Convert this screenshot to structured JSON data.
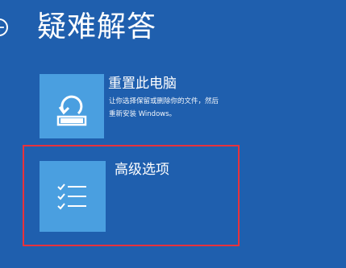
{
  "header": {
    "title": "疑难解答"
  },
  "options": [
    {
      "title": "重置此电脑",
      "description_line1": "让你选择保留或删除你的文件，然后",
      "description_line2": "重新安装 Windows。",
      "icon": "reset-pc-icon"
    },
    {
      "title": "高级选项",
      "icon": "checklist-icon"
    }
  ],
  "colors": {
    "background": "#1f5fae",
    "tile": "#4a9fe0",
    "highlight": "#e8323c"
  }
}
